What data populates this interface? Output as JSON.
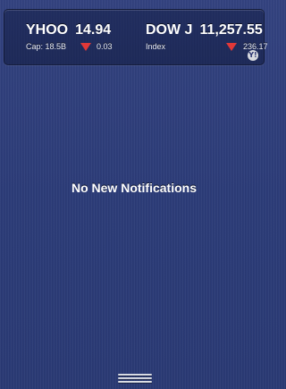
{
  "stocks_widget": {
    "tickers": [
      {
        "symbol": "YHOO",
        "price": "14.94",
        "sub_label": "Cap: 18.5B",
        "direction": "down",
        "change": "0.03"
      },
      {
        "symbol": "DOW J",
        "price": "11,257.55",
        "sub_label": "Index",
        "direction": "down",
        "change": "236.17"
      }
    ],
    "badge_icon": "yahoo-logo-icon",
    "badge_text": "Y!"
  },
  "notifications": {
    "empty_message": "No New Notifications"
  },
  "colors": {
    "background": "#2f3f7e",
    "down_arrow": "#e23838"
  }
}
